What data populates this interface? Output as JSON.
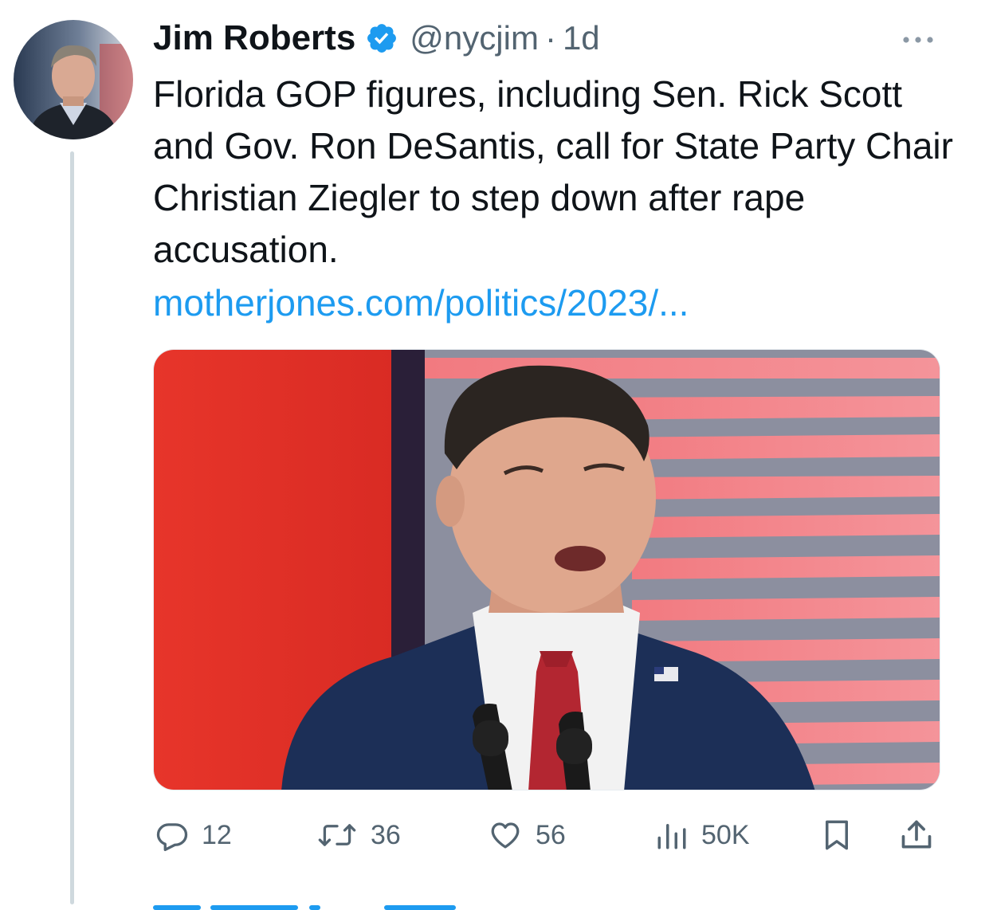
{
  "author": {
    "display_name": "Jim Roberts",
    "handle": "@nycjim",
    "separator": "·",
    "time": "1d",
    "verified_icon": "verified-badge-icon"
  },
  "tweet": {
    "text": "Florida GOP figures, including Sen. Rick Scott and Gov. Ron DeSantis, call for State Party Chair Christian Ziegler to step down after rape accusation.",
    "link": "motherjones.com/politics/2023/..."
  },
  "media": {
    "icon": "photo-man-speaking-at-podium"
  },
  "actions": {
    "replies": "12",
    "retweets": "36",
    "likes": "56",
    "views": "50K"
  },
  "colors": {
    "link": "#1d9bf0",
    "secondary_text": "#536471",
    "primary_text": "#0f1419",
    "thread_line": "#cfd9de",
    "verified": "#1d9bf0"
  }
}
